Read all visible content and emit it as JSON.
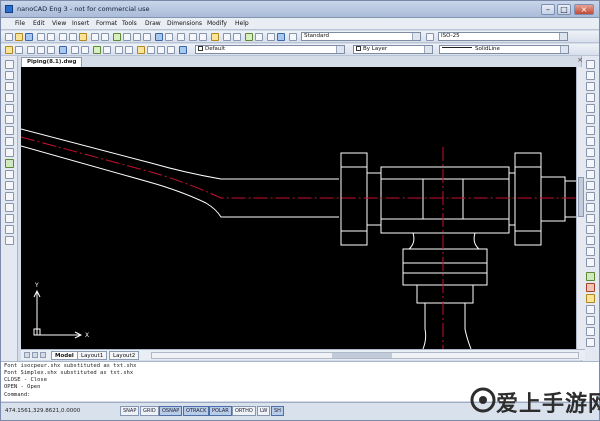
{
  "window": {
    "title": "nanoCAD Eng 3 - not for commercial use"
  },
  "menu": [
    "File",
    "Edit",
    "View",
    "Insert",
    "Format",
    "Tools",
    "Draw",
    "Dimensions",
    "Modify",
    "Help"
  ],
  "toolbar": {
    "text_style": "Standard",
    "dim_style": "ISO-25",
    "layer": "Default",
    "color": "By Layer",
    "linetype": "SolidLine"
  },
  "document": {
    "tab_title": "Piping(8.1).dwg",
    "close_glyph": "×"
  },
  "layout_tabs": [
    "Model",
    "Layout1",
    "Layout2"
  ],
  "command_history": [
    "Font isocpeur.shx substituted as txt.shx",
    "Font Simplex.shx substituted as txt.shx",
    "CLOSE - Close",
    "OPEN - Open",
    "Command:"
  ],
  "status": {
    "coordinates": "474.1561,329.8621,0.0000",
    "toggles": [
      "SNAP",
      "GRID",
      "OSNAP",
      "OTRACK",
      "POLAR",
      "ORTHO",
      "LW",
      "SH"
    ],
    "active_toggles": [
      "OSNAP",
      "OTRACK",
      "POLAR",
      "SH"
    ]
  },
  "ucs_icon": {
    "x_label": "X",
    "y_label": "Y"
  },
  "watermark": {
    "text": "爱上手游网"
  },
  "colors": {
    "canvas_bg": "#000000",
    "linework": "#ffffff",
    "centerline": "#c8102e"
  }
}
